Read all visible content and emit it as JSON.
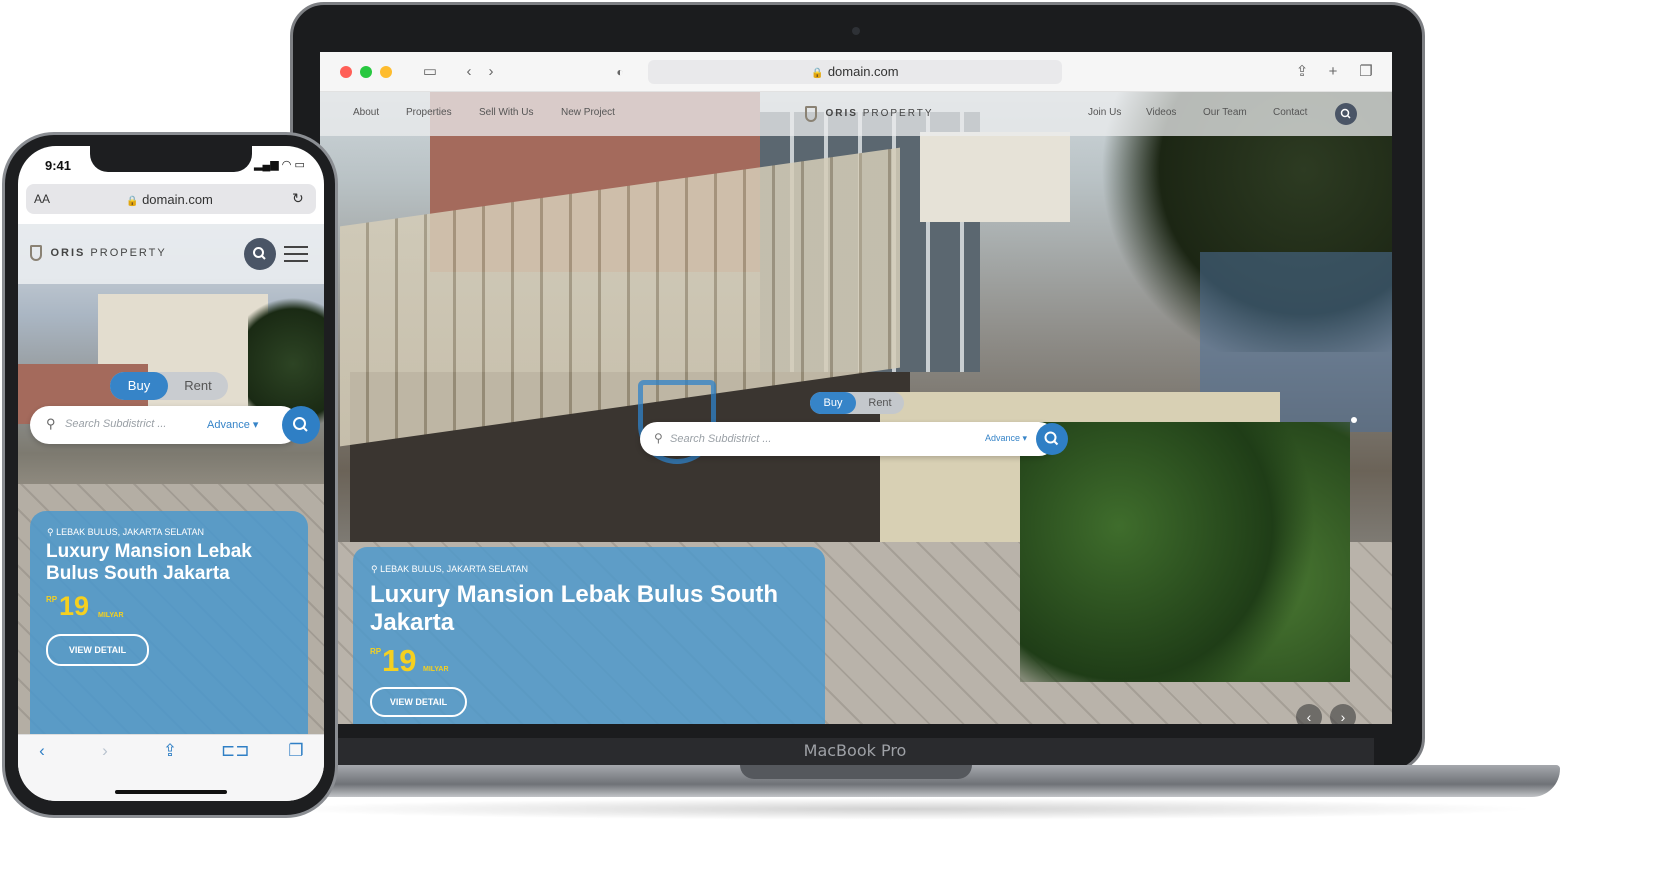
{
  "desktop": {
    "device_label": "MacBook Pro",
    "browser": {
      "url": "domain.com",
      "traffic_lights": [
        "#ff5f57",
        "#28c840",
        "#febc2e"
      ]
    },
    "nav": {
      "left_links": [
        "About",
        "Properties",
        "Sell With Us",
        "New Project"
      ],
      "brand_bold": "ORIS",
      "brand_light": "PROPERTY",
      "right_links": [
        "Join Us",
        "Videos",
        "Our Team",
        "Contact"
      ]
    },
    "search": {
      "tabs": [
        "Buy",
        "Rent"
      ],
      "active_tab": "Buy",
      "placeholder": "Search Subdistrict ...",
      "advance_label": "Advance"
    },
    "listing": {
      "location": "LEBAK BULUS, JAKARTA SELATAN",
      "title": "Luxury Mansion Lebak Bulus South Jakarta",
      "currency": "RP",
      "price": "19",
      "unit": "MILYAR",
      "cta": "VIEW DETAIL"
    }
  },
  "mobile": {
    "status_time": "9:41",
    "browser": {
      "text_size_label": "AA",
      "url": "domain.com"
    },
    "brand_bold": "ORIS",
    "brand_light": "PROPERTY",
    "search": {
      "tabs": [
        "Buy",
        "Rent"
      ],
      "active_tab": "Buy",
      "placeholder": "Search Subdistrict ...",
      "advance_label": "Advance"
    },
    "listing": {
      "location": "LEBAK BULUS, JAKARTA SELATAN",
      "title": "Luxury Mansion Lebak Bulus South Jakarta",
      "currency": "RP",
      "price": "19",
      "unit": "MILYAR",
      "cta": "VIEW DETAIL"
    }
  },
  "colors": {
    "accent_blue": "#2f7fc5",
    "price_yellow": "#f5d020",
    "card_blue": "#4a98cd"
  }
}
